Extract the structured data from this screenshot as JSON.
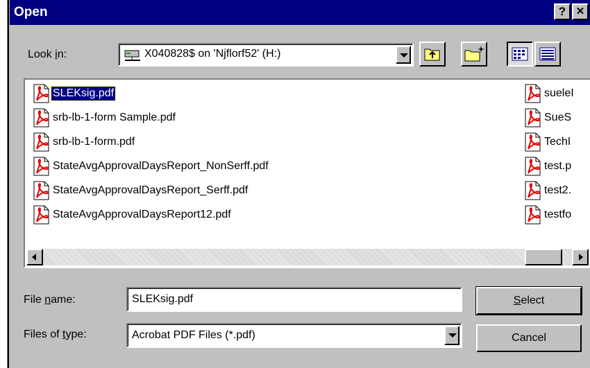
{
  "window": {
    "title": "Open",
    "help_label": "?",
    "close_label": "✕"
  },
  "look_in": {
    "label_pre": "Look ",
    "label_u": "i",
    "label_post": "n:",
    "value": "X040828$ on 'Njflorf52' (H:)",
    "icon": "network-drive-icon"
  },
  "toolbar": {
    "up_icon": "up-one-level-icon",
    "new_folder_icon": "new-folder-icon",
    "list_icon": "list-view-icon",
    "details_icon": "details-view-icon"
  },
  "files_left": [
    {
      "name": "SLEKsig.pdf",
      "selected": true
    },
    {
      "name": "srb-lb-1-form Sample.pdf",
      "selected": false
    },
    {
      "name": "srb-lb-1-form.pdf",
      "selected": false
    },
    {
      "name": "StateAvgApprovalDaysReport_NonSerff.pdf",
      "selected": false
    },
    {
      "name": "StateAvgApprovalDaysReport_Serff.pdf",
      "selected": false
    },
    {
      "name": "StateAvgApprovalDaysReport12.pdf",
      "selected": false
    }
  ],
  "files_right": [
    {
      "name": "sueleI"
    },
    {
      "name": "SueS"
    },
    {
      "name": "TechI"
    },
    {
      "name": "test.p"
    },
    {
      "name": "test2."
    },
    {
      "name": "testfo"
    }
  ],
  "file_name": {
    "label_pre": "File ",
    "label_u": "n",
    "label_post": "ame:",
    "value": "SLEKsig.pdf"
  },
  "file_type": {
    "label_pre": "Files of ",
    "label_u": "t",
    "label_post": "ype:",
    "value": "Acrobat PDF Files (*.pdf)"
  },
  "buttons": {
    "select_u": "S",
    "select_rest": "elect",
    "cancel": "Cancel"
  },
  "colors": {
    "title_bar": "#000080",
    "selection": "#000080",
    "face": "#c0c0c0",
    "pdf_red": "#e00000"
  }
}
